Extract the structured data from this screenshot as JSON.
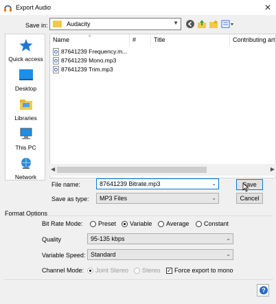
{
  "window": {
    "title": "Export Audio",
    "close_glyph": "✕"
  },
  "save_in": {
    "label": "Save in:",
    "value": "Audacity"
  },
  "places": [
    {
      "label": "Quick access",
      "icon": "star-icon"
    },
    {
      "label": "Desktop",
      "icon": "desktop-icon"
    },
    {
      "label": "Libraries",
      "icon": "libraries-icon"
    },
    {
      "label": "This PC",
      "icon": "computer-icon"
    },
    {
      "label": "Network",
      "icon": "network-icon"
    }
  ],
  "file_list": {
    "columns": [
      "Name",
      "#",
      "Title",
      "Contributing art"
    ],
    "files": [
      "87641239 Frequency.m...",
      "87641239 Mono.mp3",
      "87641239 Trim.mp3"
    ]
  },
  "file_name": {
    "label": "File name:",
    "value": "87641239 Bitrate.mp3"
  },
  "save_as_type": {
    "label": "Save as type:",
    "value": "MP3 Files"
  },
  "buttons": {
    "save": "Save",
    "cancel": "Cancel"
  },
  "format_options": {
    "label": "Format Options",
    "bit_rate_mode": {
      "label": "Bit Rate Mode:",
      "options": [
        "Preset",
        "Variable",
        "Average",
        "Constant"
      ],
      "selected": "Variable"
    },
    "quality": {
      "label": "Quality",
      "value": "95-135 kbps"
    },
    "variable_speed": {
      "label": "Variable Speed:",
      "value": "Standard"
    },
    "channel_mode": {
      "label": "Channel Mode:",
      "options": [
        "Joint Stereo",
        "Stereo"
      ],
      "force_mono_label": "Force export to mono",
      "force_mono_checked": true
    }
  },
  "help": {
    "glyph": "?"
  },
  "colors": {
    "accent": "#0078d7",
    "folder": "#f2c94c"
  }
}
